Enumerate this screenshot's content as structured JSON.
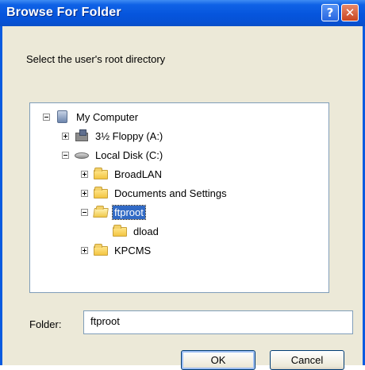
{
  "window": {
    "title": "Browse For Folder",
    "help_label": "?",
    "close_label": "✕"
  },
  "prompt": "Select the user's root directory",
  "tree": {
    "items": [
      {
        "label": "My Computer",
        "icon": "computer-icon",
        "expander": "minus"
      },
      {
        "label": "3½ Floppy (A:)",
        "icon": "floppy-drive-icon",
        "expander": "plus"
      },
      {
        "label": "Local Disk (C:)",
        "icon": "hard-disk-icon",
        "expander": "minus"
      },
      {
        "label": "BroadLAN",
        "icon": "folder-icon",
        "expander": "plus"
      },
      {
        "label": "Documents and Settings",
        "icon": "folder-icon",
        "expander": "plus"
      },
      {
        "label": "ftproot",
        "icon": "open-folder-icon",
        "expander": "minus",
        "selected": true
      },
      {
        "label": "dload",
        "icon": "folder-icon",
        "expander": "none"
      },
      {
        "label": "KPCMS",
        "icon": "folder-icon",
        "expander": "plus"
      }
    ],
    "scroll_up": "▲",
    "scroll_down": "▼"
  },
  "folder": {
    "label": "Folder:",
    "value": "ftproot"
  },
  "buttons": {
    "ok": "OK",
    "cancel": "Cancel"
  },
  "colors": {
    "title_bar": "#0655dd",
    "selection": "#316ac5",
    "dialog_bg": "#ece9d8"
  }
}
